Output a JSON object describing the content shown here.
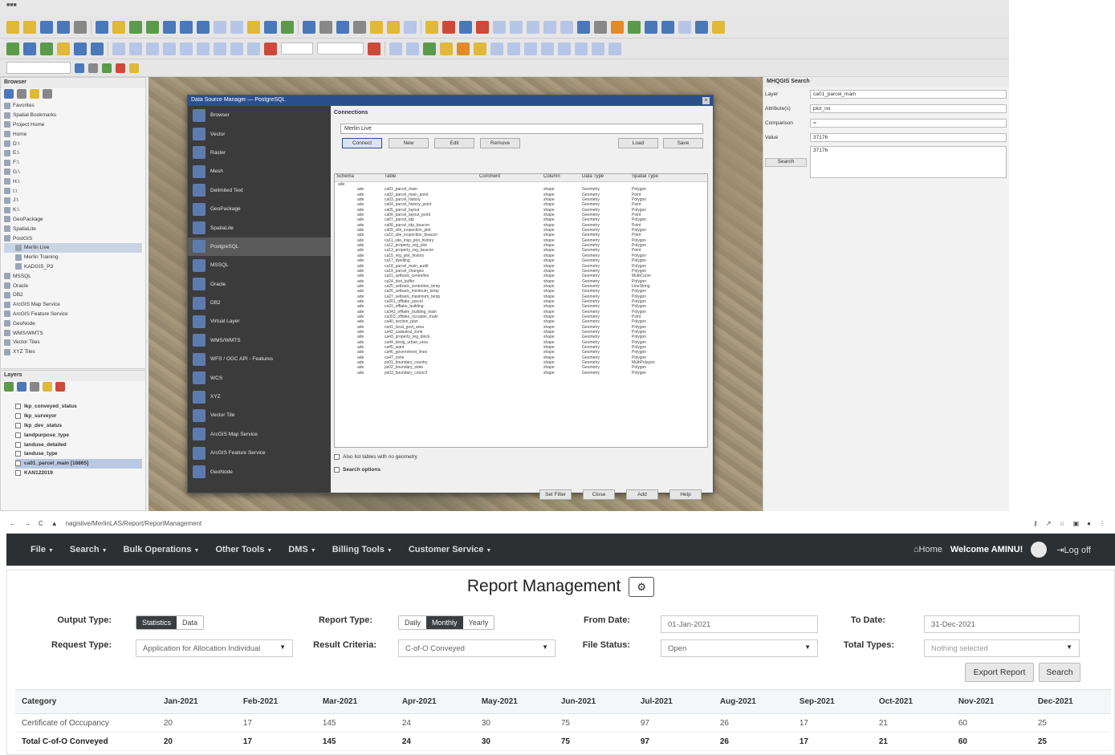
{
  "qgis": {
    "browser_panel_title": "Browser",
    "browser_items": [
      "Favorites",
      "Spatial Bookmarks",
      "Project Home",
      "Home",
      "D:\\",
      "E:\\",
      "F:\\",
      "G:\\",
      "H:\\",
      "I:\\",
      "J:\\",
      "K:\\",
      "GeoPackage",
      "SpatiaLite",
      "PostGIS",
      "Merlin Live",
      "Merlin Training",
      "KADGIS_P3",
      "MSSQL",
      "Oracle",
      "DB2",
      "ArcGIS Map Service",
      "ArcGIS Feature Service",
      "GeoNode",
      "WMS/WMTS",
      "Vector Tiles",
      "XYZ Tiles"
    ],
    "layers_panel_title": "Layers",
    "layers": [
      "lkp_conveyed_status",
      "lkp_surveyor",
      "lkp_dev_status",
      "landpurpose_type",
      "landuse_detailed",
      "landuse_type",
      "ca01_parcel_main [18865]",
      "KAN122019"
    ],
    "dialog": {
      "title": "Data Source Manager — PostgreSQL",
      "sidebar": [
        "Browser",
        "Vector",
        "Raster",
        "Mesh",
        "Delimited Text",
        "GeoPackage",
        "SpatiaLite",
        "PostgreSQL",
        "MSSQL",
        "Oracle",
        "DB2",
        "Virtual Layer",
        "WMS/WMTS",
        "WFS / OGC API - Features",
        "WCS",
        "XYZ",
        "Vector Tile",
        "ArcGIS Map Service",
        "ArcGIS Feature Service",
        "GeoNode"
      ],
      "active_item": "PostgreSQL",
      "connections_label": "Connections",
      "connection_value": "Merlin Live",
      "buttons": {
        "connect": "Connect",
        "new": "New",
        "edit": "Edit",
        "remove": "Remove",
        "load": "Load",
        "save": "Save"
      },
      "columns": [
        "Schema",
        "Table",
        "Comment",
        "Column",
        "Data Type",
        "Spatial Type"
      ],
      "root_schema": "ade",
      "rows": [
        [
          "ade",
          "ca01_parcel_main",
          "",
          "shape",
          "Geometry",
          "Polygon"
        ],
        [
          "ade",
          "ca02_parcel_main_point",
          "",
          "shape",
          "Geometry",
          "Point"
        ],
        [
          "ade",
          "ca03_parcel_history",
          "",
          "shape",
          "Geometry",
          "Polygon"
        ],
        [
          "ade",
          "ca04_parcel_history_point",
          "",
          "shape",
          "Geometry",
          "Point"
        ],
        [
          "ade",
          "ca05_parcel_layout",
          "",
          "shape",
          "Geometry",
          "Polygon"
        ],
        [
          "ade",
          "ca06_parcel_layout_point",
          "",
          "shape",
          "Geometry",
          "Point"
        ],
        [
          "ade",
          "ca07_parcel_tdp",
          "",
          "shape",
          "Geometry",
          "Polygon"
        ],
        [
          "ade",
          "ca08_parcel_tdp_beacon",
          "",
          "shape",
          "Geometry",
          "Point"
        ],
        [
          "ade",
          "ca09_site_inspection_plot",
          "",
          "shape",
          "Geometry",
          "Polygon"
        ],
        [
          "ade",
          "ca10_site_inspection_beacon",
          "",
          "shape",
          "Geometry",
          "Point"
        ],
        [
          "ade",
          "ca11_site_insp_plot_history",
          "",
          "shape",
          "Geometry",
          "Polygon"
        ],
        [
          "ade",
          "ca12_property_reg_plot",
          "",
          "shape",
          "Geometry",
          "Polygon"
        ],
        [
          "ade",
          "ca13_property_reg_beacon",
          "",
          "shape",
          "Geometry",
          "Point"
        ],
        [
          "ade",
          "ca15_reg_plot_history",
          "",
          "shape",
          "Geometry",
          "Polygon"
        ],
        [
          "ade",
          "ca17_dwelling",
          "",
          "shape",
          "Geometry",
          "Polygon"
        ],
        [
          "ade",
          "ca18_parcel_main_audit",
          "",
          "shape",
          "Geometry",
          "Polygon"
        ],
        [
          "ade",
          "ca19_parcel_changes",
          "",
          "shape",
          "Geometry",
          "Polygon"
        ],
        [
          "ade",
          "ca21_setback_centreline",
          "",
          "shape",
          "Geometry",
          "MultiCurve"
        ],
        [
          "ade",
          "ca24_dod_buffer",
          "",
          "shape",
          "Geometry",
          "Polygon"
        ],
        [
          "ade",
          "ca25_setback_centreline_temp",
          "",
          "shape",
          "Geometry",
          "LineString"
        ],
        [
          "ade",
          "ca26_setback_minimum_temp",
          "",
          "shape",
          "Geometry",
          "Polygon"
        ],
        [
          "ade",
          "ca27_setback_maximum_temp",
          "",
          "shape",
          "Geometry",
          "Polygon"
        ],
        [
          "ade",
          "ca301_offtake_parcel",
          "",
          "shape",
          "Geometry",
          "Polygon"
        ],
        [
          "ade",
          "ca31_offtake_building",
          "",
          "shape",
          "Geometry",
          "Polygon"
        ],
        [
          "ade",
          "ca342_offtake_building_main",
          "",
          "shape",
          "Geometry",
          "Polygon"
        ],
        [
          "ade",
          "ca303_offtake_occupier_main",
          "",
          "shape",
          "Geometry",
          "Point"
        ],
        [
          "ade",
          "ca40_section_plan",
          "",
          "shape",
          "Geometry",
          "Polygon"
        ],
        [
          "ade",
          "ca41_local_govt_area",
          "",
          "shape",
          "Geometry",
          "Polygon"
        ],
        [
          "ade",
          "ca42_cadastral_zone",
          "",
          "shape",
          "Geometry",
          "Polygon"
        ],
        [
          "ade",
          "ca43_property_reg_block",
          "",
          "shape",
          "Geometry",
          "Polygon"
        ],
        [
          "ade",
          "ca44_desig_urban_area",
          "",
          "shape",
          "Geometry",
          "Polygon"
        ],
        [
          "ade",
          "ca45_ward",
          "",
          "shape",
          "Geometry",
          "Polygon"
        ],
        [
          "ade",
          "ca46_government_lines",
          "",
          "shape",
          "Geometry",
          "Polygon"
        ],
        [
          "ade",
          "ca47_zone",
          "",
          "shape",
          "Geometry",
          "Polygon"
        ],
        [
          "ade",
          "ps01_boundary_country",
          "",
          "shape",
          "Geometry",
          "MultiPolygon"
        ],
        [
          "ade",
          "ps02_boundary_state",
          "",
          "shape",
          "Geometry",
          "Polygon"
        ],
        [
          "ade",
          "ps03_boundary_council",
          "",
          "shape",
          "Geometry",
          "Polygon"
        ]
      ],
      "also_list": "Also list tables with no geometry",
      "search_options": "Search options",
      "footer": {
        "set_filter": "Set Filter",
        "close": "Close",
        "add": "Add",
        "help": "Help"
      }
    },
    "search_panel": {
      "title": "MHQGIS Search",
      "layer_label": "Layer",
      "layer_value": "ca01_parcel_main",
      "attribute_label": "Attribute(s)",
      "attribute_value": "plot_no",
      "comparison_label": "Comparison",
      "comparison_value": "=",
      "value_label": "Value",
      "value_value": "37176",
      "search_button": "Search",
      "result": "37176"
    }
  },
  "browser": {
    "url": "nagislive/MerlinLAS/Report/ReportManagement"
  },
  "nav": {
    "menus": [
      "File",
      "Search",
      "Bulk Operations",
      "Other Tools",
      "DMS",
      "Billing Tools",
      "Customer Service"
    ],
    "home": "Home",
    "welcome": "Welcome AMINU!",
    "logoff": "Log off"
  },
  "report": {
    "title": "Report Management",
    "gear": "⚙",
    "output_type_label": "Output Type:",
    "output_type_options": [
      "Statistics",
      "Data"
    ],
    "output_type_selected": "Statistics",
    "report_type_label": "Report Type:",
    "report_type_options": [
      "Daily",
      "Monthly",
      "Yearly"
    ],
    "report_type_selected": "Monthly",
    "from_date_label": "From Date:",
    "from_date": "01-Jan-2021",
    "to_date_label": "To Date:",
    "to_date": "31-Dec-2021",
    "request_type_label": "Request Type:",
    "request_type": "Application for Allocation Individual",
    "result_criteria_label": "Result Criteria:",
    "result_criteria": "C-of-O Conveyed",
    "file_status_label": "File Status:",
    "file_status": "Open",
    "total_types_label": "Total Types:",
    "total_types_placeholder": "Nothing selected",
    "export_button": "Export Report",
    "search_button": "Search",
    "table": {
      "headers": [
        "Category",
        "Jan-2021",
        "Feb-2021",
        "Mar-2021",
        "Apr-2021",
        "May-2021",
        "Jun-2021",
        "Jul-2021",
        "Aug-2021",
        "Sep-2021",
        "Oct-2021",
        "Nov-2021",
        "Dec-2021"
      ],
      "rows": [
        [
          "Certificate of Occupancy",
          "20",
          "17",
          "145",
          "24",
          "30",
          "75",
          "97",
          "26",
          "17",
          "21",
          "60",
          "25"
        ]
      ],
      "total": [
        "Total C-of-O Conveyed",
        "20",
        "17",
        "145",
        "24",
        "30",
        "75",
        "97",
        "26",
        "17",
        "21",
        "60",
        "25"
      ]
    }
  }
}
